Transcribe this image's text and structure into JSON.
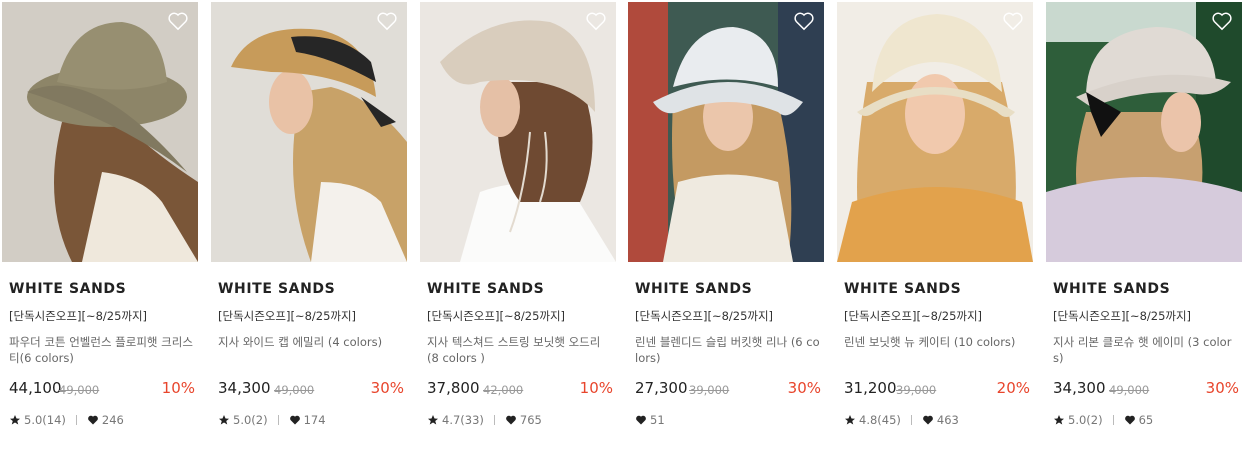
{
  "products": [
    {
      "brand": "WHITE SANDS",
      "tag": "[단독시즌오프][~8/25까지]",
      "name": "파우더 코튼 언벨런스 플로피햇 크리스티(6 colors)",
      "price": "44,100",
      "original_price": "49,000",
      "discount": "10%",
      "rating": "5.0(14)",
      "likes": "246",
      "icons": {
        "wishlist": "heart-outline-icon",
        "rating": "star-icon",
        "likes": "heart-icon"
      }
    },
    {
      "brand": "WHITE SANDS",
      "tag": "[단독시즌오프][~8/25까지]",
      "name": "지사 와이드 캡 에밀리 (4 colors)",
      "price": "34,300",
      "original_price": "49,000",
      "discount": "30%",
      "rating": "5.0(2)",
      "likes": "174"
    },
    {
      "brand": "WHITE SANDS",
      "tag": "[단독시즌오프][~8/25까지]",
      "name": "지사 텍스쳐드 스트링 보닛햇 오드리 (8 colors )",
      "price": "37,800",
      "original_price": "42,000",
      "discount": "10%",
      "rating": "4.7(33)",
      "likes": "765"
    },
    {
      "brand": "WHITE SANDS",
      "tag": "[단독시즌오프][~8/25까지]",
      "name": "린넨 블렌디드 슬립 버킷햇 리나 (6 colors)",
      "price": "27,300",
      "original_price": "39,000",
      "discount": "30%",
      "rating": "",
      "likes": "51"
    },
    {
      "brand": "WHITE SANDS",
      "tag": "[단독시즌오프][~8/25까지]",
      "name": "린넨 보닛햇 뉴 케이티 (10 colors)",
      "price": "31,200",
      "original_price": "39,000",
      "discount": "20%",
      "rating": "4.8(45)",
      "likes": "463"
    },
    {
      "brand": "WHITE SANDS",
      "tag": "[단독시즌오프][~8/25까지]",
      "name": "지사 리본 클로슈 햇 에이미 (3 colors)",
      "price": "34,300",
      "original_price": "49,000",
      "discount": "30%",
      "rating": "5.0(2)",
      "likes": "65"
    }
  ],
  "colors": {
    "discount": "#e8452c",
    "strike": "#999999",
    "text": "#222222"
  }
}
